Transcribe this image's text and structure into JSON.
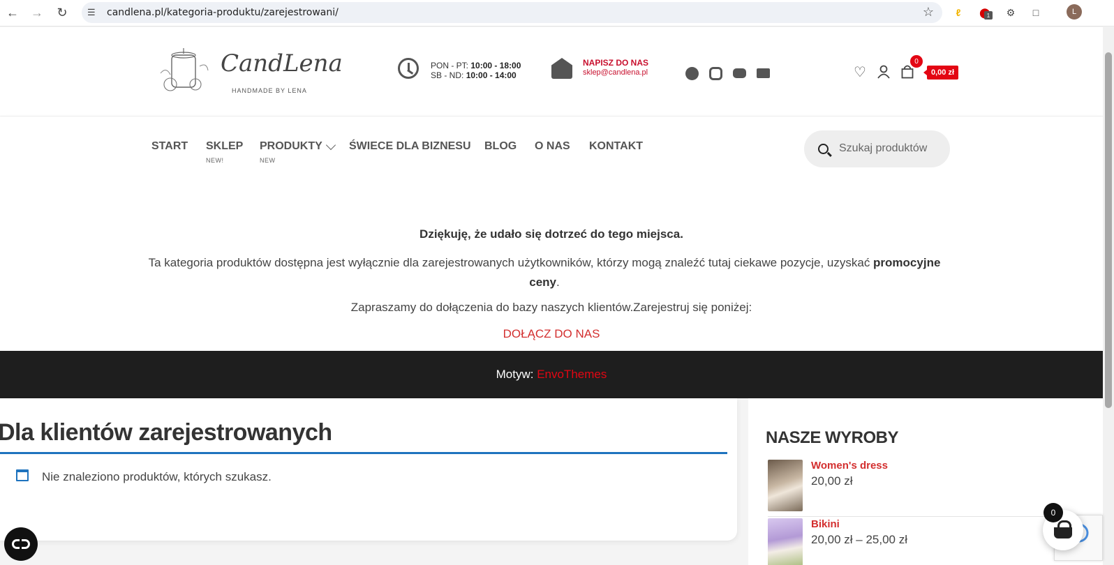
{
  "browser": {
    "url": "candlena.pl/kategoria-produktu/zarejestrowani/",
    "extension_badge": "1",
    "profile_initial": "L"
  },
  "header": {
    "logo": {
      "script": "CandLena",
      "tagline": "HANDMADE BY LENA"
    },
    "hours": {
      "weekdays_label": "PON - PT:",
      "weekdays_time": "10:00 - 18:00",
      "weekend_label": "SB - ND:",
      "weekend_time": "10:00 - 14:00"
    },
    "contact": {
      "title": "NAPISZ DO NAS",
      "email": "sklep@candlena.pl"
    },
    "cart": {
      "count": "0",
      "total": "0,00 zł"
    }
  },
  "nav": {
    "items": [
      {
        "label": "START",
        "sub": ""
      },
      {
        "label": "SKLEP",
        "sub": "NEW!"
      },
      {
        "label": "PRODUKTY",
        "sub": "NEW"
      },
      {
        "label": "ŚWIECE DLA BIZNESU",
        "sub": ""
      },
      {
        "label": "BLOG",
        "sub": ""
      },
      {
        "label": "O NAS",
        "sub": ""
      },
      {
        "label": "KONTAKT",
        "sub": ""
      }
    ],
    "search_placeholder": "Szukaj produktów"
  },
  "notice": {
    "heading": "Dziękuję, że udało się dotrzeć do tego miejsca.",
    "body_start": "Ta kategoria produktów dostępna jest wyłącznie dla zarejestrowanych użytkowników, którzy mogą znaleźć tutaj ciekawe pozycje, uzyskać ",
    "body_bold": "promocyjne ceny",
    "body_end": ".",
    "invite": "Zapraszamy do dołączenia do bazy naszych klientów.Zarejestruj się poniżej:",
    "join_link": "DOŁĄCZ DO NAS"
  },
  "footer": {
    "theme_label": "Motyw: ",
    "theme_link": "EnvoThemes"
  },
  "main": {
    "title": "Dla klientów zarejestrowanych",
    "empty_message": "Nie znaleziono produktów, których szukasz."
  },
  "sidebar": {
    "title": "NASZE WYROBY",
    "products": [
      {
        "name": "Women's dress",
        "price": "20,00 zł"
      },
      {
        "name": "Bikini",
        "price": "20,00 zł – 25,00 zł"
      }
    ]
  },
  "floating_cart": {
    "count": "0"
  },
  "colors": {
    "accent_red": "#e30613",
    "link_red": "#d32f2f",
    "rule_blue": "#1e73be",
    "footer_dark": "#1e1e1e"
  }
}
